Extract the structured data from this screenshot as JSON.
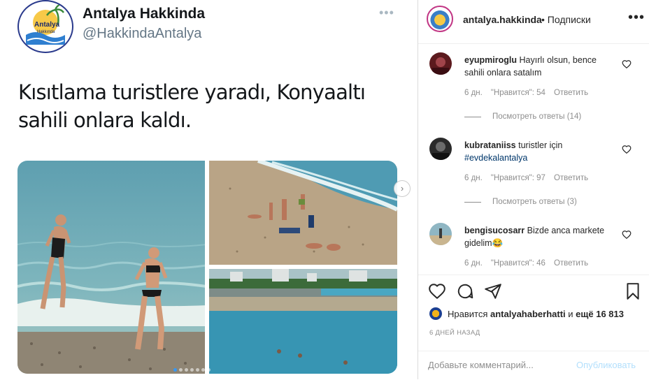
{
  "tweet": {
    "name": "Antalya Hakkinda",
    "handle": "@HakkindaAntalya",
    "more": "•••",
    "text": "Kısıtlama turistlere yaradı, Konyaaltı sahili onlara kaldı.",
    "logo_text_top": "Antalya",
    "logo_text_bottom": "Hakkında"
  },
  "carousel": {
    "next": "›",
    "dot_count": 7,
    "active_dot": 0
  },
  "post": {
    "username": "antalya.hakkinda",
    "follow_sep": "• Подписки",
    "more": "•••"
  },
  "comments": [
    {
      "user": "eyupmiroglu",
      "text": "Hayırlı olsun, bence sahili onlara satalım",
      "age": "6 дн.",
      "likes": "\"Нравится\": 54",
      "reply": "Ответить",
      "replies": "Посмотреть ответы (14)"
    },
    {
      "user": "kubrataniiss",
      "text": "turistler için",
      "tag": "#evdekalantalya",
      "age": "6 дн.",
      "likes": "\"Нравится\": 97",
      "reply": "Ответить",
      "replies": "Посмотреть ответы (3)"
    },
    {
      "user": "bengisucosarr",
      "text": "Bizde anca markete gidelim😂",
      "age": "6 дн.",
      "likes": "\"Нравится\": 46",
      "reply": "Ответить"
    }
  ],
  "likes": {
    "prefix": "Нравится",
    "user": "antalyahaberhatti",
    "mid": "и",
    "rest": "ещё 16 813"
  },
  "timestamp": "6 ДНЕЙ НАЗАД",
  "comment_input": {
    "placeholder": "Добавьте комментарий...",
    "publish": "Опубликовать"
  }
}
